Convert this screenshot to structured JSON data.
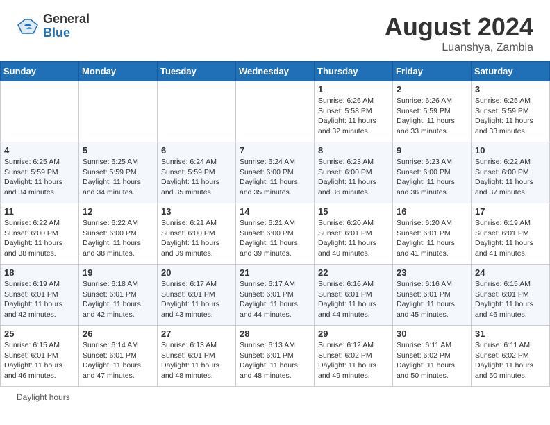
{
  "header": {
    "logo_general": "General",
    "logo_blue": "Blue",
    "month_year": "August 2024",
    "location": "Luanshya, Zambia"
  },
  "calendar": {
    "days_of_week": [
      "Sunday",
      "Monday",
      "Tuesday",
      "Wednesday",
      "Thursday",
      "Friday",
      "Saturday"
    ],
    "weeks": [
      [
        {
          "day": "",
          "info": ""
        },
        {
          "day": "",
          "info": ""
        },
        {
          "day": "",
          "info": ""
        },
        {
          "day": "",
          "info": ""
        },
        {
          "day": "1",
          "info": "Sunrise: 6:26 AM\nSunset: 5:58 PM\nDaylight: 11 hours and 32 minutes."
        },
        {
          "day": "2",
          "info": "Sunrise: 6:26 AM\nSunset: 5:59 PM\nDaylight: 11 hours and 33 minutes."
        },
        {
          "day": "3",
          "info": "Sunrise: 6:25 AM\nSunset: 5:59 PM\nDaylight: 11 hours and 33 minutes."
        }
      ],
      [
        {
          "day": "4",
          "info": "Sunrise: 6:25 AM\nSunset: 5:59 PM\nDaylight: 11 hours and 34 minutes."
        },
        {
          "day": "5",
          "info": "Sunrise: 6:25 AM\nSunset: 5:59 PM\nDaylight: 11 hours and 34 minutes."
        },
        {
          "day": "6",
          "info": "Sunrise: 6:24 AM\nSunset: 5:59 PM\nDaylight: 11 hours and 35 minutes."
        },
        {
          "day": "7",
          "info": "Sunrise: 6:24 AM\nSunset: 6:00 PM\nDaylight: 11 hours and 35 minutes."
        },
        {
          "day": "8",
          "info": "Sunrise: 6:23 AM\nSunset: 6:00 PM\nDaylight: 11 hours and 36 minutes."
        },
        {
          "day": "9",
          "info": "Sunrise: 6:23 AM\nSunset: 6:00 PM\nDaylight: 11 hours and 36 minutes."
        },
        {
          "day": "10",
          "info": "Sunrise: 6:22 AM\nSunset: 6:00 PM\nDaylight: 11 hours and 37 minutes."
        }
      ],
      [
        {
          "day": "11",
          "info": "Sunrise: 6:22 AM\nSunset: 6:00 PM\nDaylight: 11 hours and 38 minutes."
        },
        {
          "day": "12",
          "info": "Sunrise: 6:22 AM\nSunset: 6:00 PM\nDaylight: 11 hours and 38 minutes."
        },
        {
          "day": "13",
          "info": "Sunrise: 6:21 AM\nSunset: 6:00 PM\nDaylight: 11 hours and 39 minutes."
        },
        {
          "day": "14",
          "info": "Sunrise: 6:21 AM\nSunset: 6:00 PM\nDaylight: 11 hours and 39 minutes."
        },
        {
          "day": "15",
          "info": "Sunrise: 6:20 AM\nSunset: 6:01 PM\nDaylight: 11 hours and 40 minutes."
        },
        {
          "day": "16",
          "info": "Sunrise: 6:20 AM\nSunset: 6:01 PM\nDaylight: 11 hours and 41 minutes."
        },
        {
          "day": "17",
          "info": "Sunrise: 6:19 AM\nSunset: 6:01 PM\nDaylight: 11 hours and 41 minutes."
        }
      ],
      [
        {
          "day": "18",
          "info": "Sunrise: 6:19 AM\nSunset: 6:01 PM\nDaylight: 11 hours and 42 minutes."
        },
        {
          "day": "19",
          "info": "Sunrise: 6:18 AM\nSunset: 6:01 PM\nDaylight: 11 hours and 42 minutes."
        },
        {
          "day": "20",
          "info": "Sunrise: 6:17 AM\nSunset: 6:01 PM\nDaylight: 11 hours and 43 minutes."
        },
        {
          "day": "21",
          "info": "Sunrise: 6:17 AM\nSunset: 6:01 PM\nDaylight: 11 hours and 44 minutes."
        },
        {
          "day": "22",
          "info": "Sunrise: 6:16 AM\nSunset: 6:01 PM\nDaylight: 11 hours and 44 minutes."
        },
        {
          "day": "23",
          "info": "Sunrise: 6:16 AM\nSunset: 6:01 PM\nDaylight: 11 hours and 45 minutes."
        },
        {
          "day": "24",
          "info": "Sunrise: 6:15 AM\nSunset: 6:01 PM\nDaylight: 11 hours and 46 minutes."
        }
      ],
      [
        {
          "day": "25",
          "info": "Sunrise: 6:15 AM\nSunset: 6:01 PM\nDaylight: 11 hours and 46 minutes."
        },
        {
          "day": "26",
          "info": "Sunrise: 6:14 AM\nSunset: 6:01 PM\nDaylight: 11 hours and 47 minutes."
        },
        {
          "day": "27",
          "info": "Sunrise: 6:13 AM\nSunset: 6:01 PM\nDaylight: 11 hours and 48 minutes."
        },
        {
          "day": "28",
          "info": "Sunrise: 6:13 AM\nSunset: 6:01 PM\nDaylight: 11 hours and 48 minutes."
        },
        {
          "day": "29",
          "info": "Sunrise: 6:12 AM\nSunset: 6:02 PM\nDaylight: 11 hours and 49 minutes."
        },
        {
          "day": "30",
          "info": "Sunrise: 6:11 AM\nSunset: 6:02 PM\nDaylight: 11 hours and 50 minutes."
        },
        {
          "day": "31",
          "info": "Sunrise: 6:11 AM\nSunset: 6:02 PM\nDaylight: 11 hours and 50 minutes."
        }
      ]
    ]
  },
  "footer": {
    "daylight_label": "Daylight hours"
  }
}
